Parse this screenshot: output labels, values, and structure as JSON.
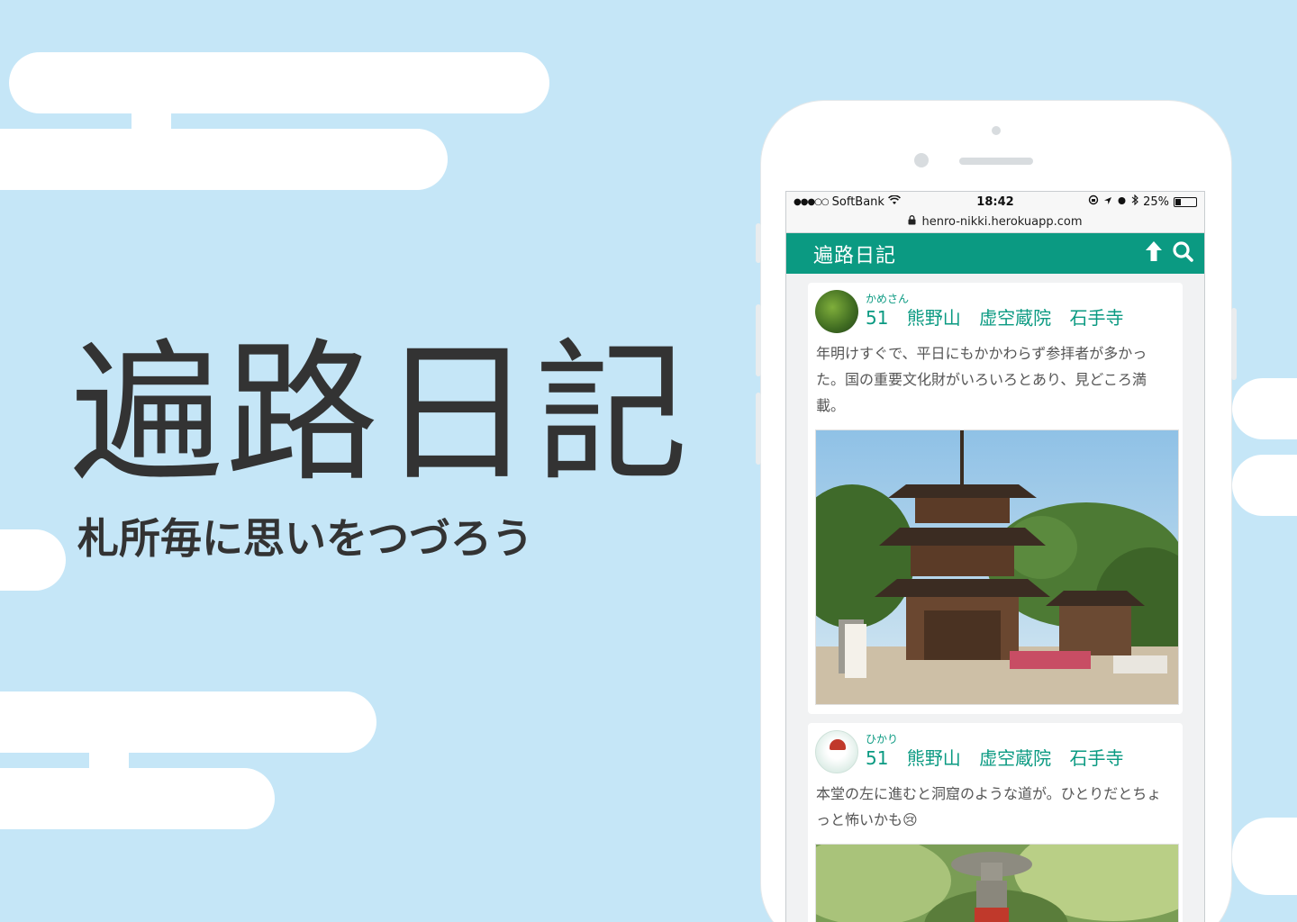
{
  "hero": {
    "title": "遍路日記",
    "subtitle": "札所毎に思いをつづろう"
  },
  "statusbar": {
    "signal": "●●●○○",
    "carrier": "SoftBank",
    "wifi_icon": "wifi-icon",
    "time": "18:42",
    "battery": "25%"
  },
  "browser": {
    "url": "henro-nikki.herokuapp.com",
    "lock_icon": "lock-icon"
  },
  "app": {
    "title": "遍路日記",
    "upload_icon": "upload-arrow-icon",
    "search_icon": "search-icon"
  },
  "posts": [
    {
      "user": "かめさん",
      "temple": "51 熊野山 虚空蔵院 石手寺",
      "body": "年明けすぐで、平日にもかかわらず参拝者が多かった。国の重要文化財がいろいろとあり、見どころ満載。"
    },
    {
      "user": "ひかり",
      "temple": "51 熊野山 虚空蔵院 石手寺",
      "body": "本堂の左に進むと洞窟のような道が。ひとりだとちょっと怖いかも😢"
    }
  ],
  "colors": {
    "background": "#c5e6f7",
    "accent": "#0b9a82",
    "text": "#333333"
  }
}
